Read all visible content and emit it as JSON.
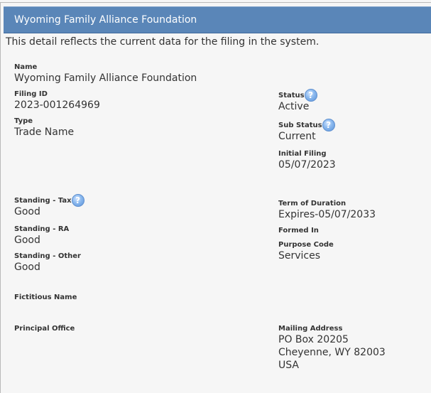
{
  "header": {
    "title": "Wyoming Family Alliance Foundation"
  },
  "intro": "This detail reflects the current data for the filing in the system.",
  "help_icon": {
    "glyph": "?",
    "color": "#6aa3e6"
  },
  "left": {
    "name": {
      "label": "Name",
      "value": "Wyoming Family Alliance Foundation"
    },
    "filing_id": {
      "label": "Filing ID",
      "value": "2023-001264969"
    },
    "type": {
      "label": "Type",
      "value": "Trade Name"
    },
    "standing_tax": {
      "label": "Standing - Tax",
      "value": "Good"
    },
    "standing_ra": {
      "label": "Standing - RA",
      "value": "Good"
    },
    "standing_other": {
      "label": "Standing - Other",
      "value": "Good"
    },
    "fictitious_name": {
      "label": "Fictitious Name",
      "value": ""
    },
    "principal_office": {
      "label": "Principal Office",
      "value": ""
    }
  },
  "right": {
    "status": {
      "label": "Status",
      "value": "Active"
    },
    "sub_status": {
      "label": "Sub Status",
      "value": "Current"
    },
    "initial_filing": {
      "label": "Initial Filing",
      "value": "05/07/2023"
    },
    "term_of_duration": {
      "label": "Term of Duration",
      "value": "Expires-05/07/2033"
    },
    "formed_in": {
      "label": "Formed In",
      "value": ""
    },
    "purpose_code": {
      "label": "Purpose Code",
      "value": "Services"
    },
    "mailing_address": {
      "label": "Mailing Address",
      "line1": "PO Box 20205",
      "line2": "Cheyenne, WY 82003",
      "line3": "USA"
    }
  }
}
